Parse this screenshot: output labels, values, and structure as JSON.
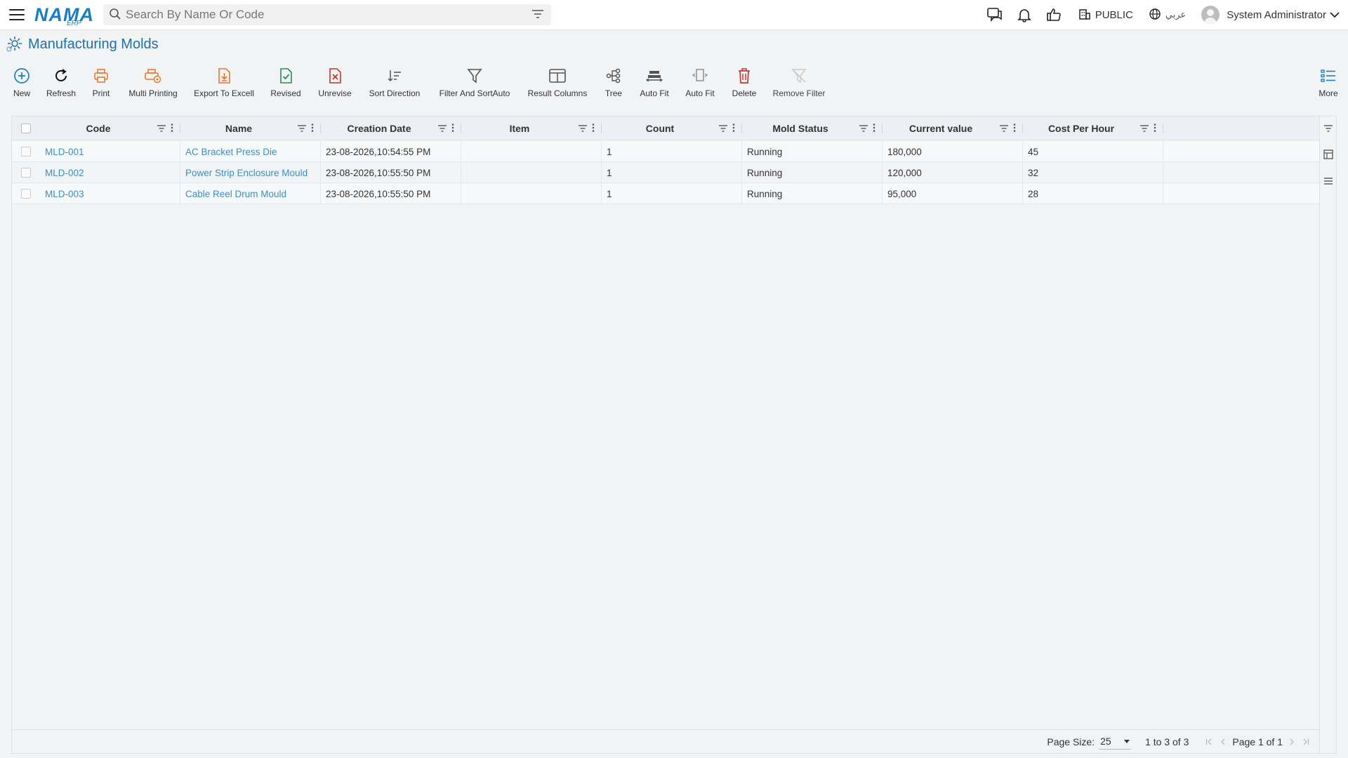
{
  "app": {
    "logo_text": "NAMA",
    "logo_sub": "ERP"
  },
  "search": {
    "placeholder": "Search By Name Or Code"
  },
  "topbar": {
    "branch": "PUBLIC",
    "language": "عربي",
    "user": "System Administrator"
  },
  "page": {
    "title": "Manufacturing Molds"
  },
  "toolbar": {
    "new": "New",
    "refresh": "Refresh",
    "print": "Print",
    "multi_printing": "Multi Printing",
    "export_excel": "Export To Excell",
    "revised": "Revised",
    "unrevise": "Unrevise",
    "sort_direction": "Sort Direction",
    "filter_sort": "Filter And SortAuto",
    "result_columns": "Result Columns",
    "tree": "Tree",
    "auto_fit_1": "Auto Fit",
    "auto_fit_2": "Auto Fit",
    "delete": "Delete",
    "remove_filter": "Remove Filter",
    "more": "More"
  },
  "grid": {
    "columns": [
      "Code",
      "Name",
      "Creation Date",
      "Item",
      "Count",
      "Mold Status",
      "Current value",
      "Cost Per Hour"
    ],
    "rows": [
      [
        "MLD-001",
        "AC Bracket Press Die",
        "23-08-2026,10:54:55 PM",
        "",
        "1",
        "Running",
        "180,000",
        "45"
      ],
      [
        "MLD-002",
        "Power Strip Enclosure Mould",
        "23-08-2026,10:55:50 PM",
        "",
        "1",
        "Running",
        "120,000",
        "32"
      ],
      [
        "MLD-003",
        "Cable Reel Drum Mould",
        "23-08-2026,10:55:50 PM",
        "",
        "1",
        "Running",
        "95,000",
        "28"
      ]
    ]
  },
  "footer": {
    "page_size_label": "Page Size:",
    "page_size": "25",
    "range": "1 to 3 of 3",
    "page_info": "Page 1 of 1"
  },
  "colors": {
    "accent": "#1a7fc1",
    "link": "#3d8fc4",
    "orange": "#e8772e",
    "green": "#2e8b57",
    "red": "#c0392b"
  }
}
